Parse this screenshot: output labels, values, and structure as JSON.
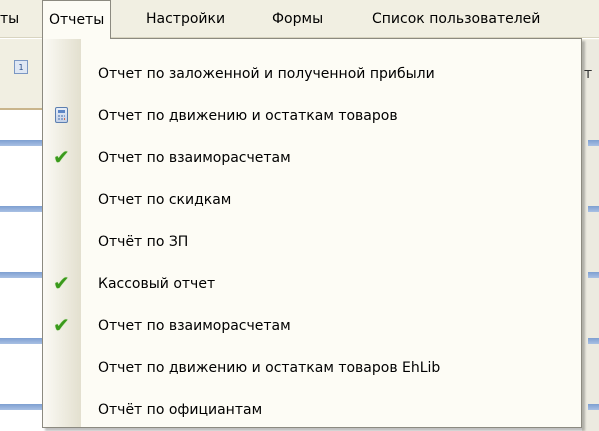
{
  "menubar": {
    "items": [
      {
        "label": "ты"
      },
      {
        "label": "Отчеты"
      },
      {
        "label": "Настройки"
      },
      {
        "label": "Формы"
      },
      {
        "label": "Список пользователей"
      }
    ]
  },
  "toolbar": {
    "button_glyph": "1",
    "right_edge_fragment": "т"
  },
  "reports_menu": {
    "items": [
      {
        "label": "Отчет по заложенной и полученной прибыли",
        "icon": "none"
      },
      {
        "label": "Отчет по движению и остаткам товаров",
        "icon": "calculator-icon"
      },
      {
        "label": "Отчет по взаиморасчетам",
        "icon": "checkmark-icon"
      },
      {
        "label": "Отчет по скидкам",
        "icon": "none"
      },
      {
        "label": "Отчёт по ЗП",
        "icon": "none"
      },
      {
        "label": "Кассовый отчет",
        "icon": "checkmark-icon"
      },
      {
        "label": "Отчет по взаиморасчетам",
        "icon": "checkmark-icon"
      },
      {
        "label": "Отчет по движению и остаткам товаров EhLib",
        "icon": "none"
      },
      {
        "label": "Отчёт по официантам",
        "icon": "none"
      }
    ]
  },
  "colors": {
    "menu_background": "#fdfcf5",
    "menubar_background": "#f1efe2",
    "checkmark": "#3a9a1c",
    "row_stripe": "#7e9fd1"
  }
}
